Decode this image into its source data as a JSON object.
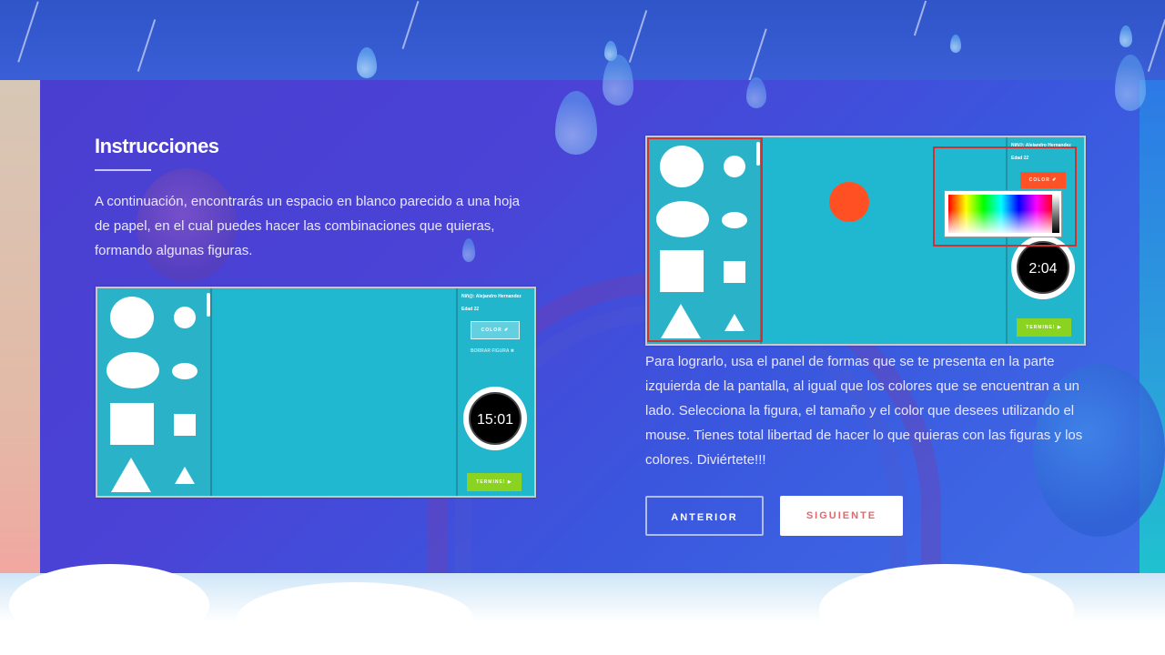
{
  "page": {
    "title": "Instrucciones",
    "intro_text": "A continuación, encontrarás un espacio en blanco parecido a una hoja de papel, en el cual puedes hacer las combinaciones que quieras, formando algunas figuras.",
    "detail_text": "Para lograrlo, usa el panel de formas que se te presenta en la parte izquierda de la pantalla, al igual que los colores que se encuentran a un lado. Selecciona la figura, el tamaño y el color que desees utilizando el mouse. Tienes total libertad de hacer lo que quieras con las figuras y los colores. Diviértete!!!"
  },
  "screenshot1": {
    "user_label": "Niñ@: Alejandro Hernandez",
    "age_label": "Edad 22",
    "color_button": "COLOR ✐",
    "delete_button": "BORRAR FIGURA ✖",
    "timer": "15:01",
    "finish_button": "TERMINE! ▶"
  },
  "screenshot2": {
    "user_label": "Niñ@: Alejandro Hernandez",
    "age_label": "Edad 22",
    "color_button": "COLOR ✐",
    "timer": "2:04",
    "finish_button": "TERMINE! ▶",
    "shape_color": "#ff5024"
  },
  "nav": {
    "prev_label": "ANTERIOR",
    "next_label": "SIGUIENTE"
  }
}
